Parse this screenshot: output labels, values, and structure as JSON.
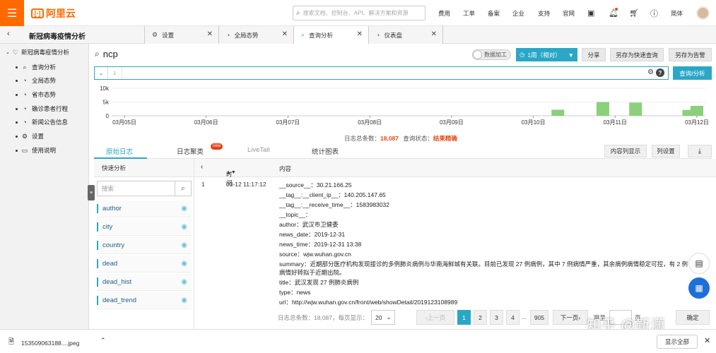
{
  "topbar": {
    "logo_text": "阿里云",
    "search_placeholder": "搜索文档、控制台、API、解决方案和资源",
    "nav": [
      "费用",
      "工单",
      "备案",
      "企业",
      "支持",
      "官网"
    ],
    "lang": "简体",
    "icons": [
      "monitor-icon",
      "bell-icon",
      "cart-icon",
      "help-icon"
    ]
  },
  "tabrow": {
    "project_title": "新冠病毒疫情分析",
    "tabs": [
      {
        "label": "设置",
        "icon": "gear-icon"
      },
      {
        "label": "全局态势",
        "icon": "dashboard-icon"
      },
      {
        "label": "查询分析",
        "icon": "search-icon"
      },
      {
        "label": "仪表盘",
        "icon": "dashboard-icon"
      }
    ],
    "active_tab": "查询分析"
  },
  "sidebar": {
    "header": "新冠病毒疫情分析",
    "items": [
      {
        "label": "查询分析",
        "icon": "search-icon"
      },
      {
        "label": "全局态势",
        "icon": "dashboard-icon"
      },
      {
        "label": "省市态势",
        "icon": "dashboard-icon"
      },
      {
        "label": "确诊患者行程",
        "icon": "dashboard-icon"
      },
      {
        "label": "新闻公告信息",
        "icon": "dashboard-icon"
      },
      {
        "label": "设置",
        "icon": "gear-icon"
      },
      {
        "label": "使用说明",
        "icon": "book-icon"
      }
    ]
  },
  "main": {
    "logstore_name": "ncp",
    "toggle_label": "数据加工",
    "time_range": "1周（相对）",
    "buttons": {
      "share": "分享",
      "save_search": "另存为快速查询",
      "save_alert": "另存为告警"
    },
    "query": {
      "line_number": "1",
      "text": "",
      "submit_label": "查询/分析"
    }
  },
  "histogram": {
    "yticks": [
      "10k",
      "5k",
      "0"
    ],
    "xticks": [
      "03月05日",
      "03月06日",
      "03月07日",
      "03月08日",
      "03月09日",
      "03月10日",
      "03月11日",
      "03月12日"
    ],
    "ymax": 10000,
    "bars": [
      {
        "position": 5.3,
        "value": 2200
      },
      {
        "position": 5.85,
        "value": 5000
      },
      {
        "position": 6.25,
        "value": 4800
      },
      {
        "position": 6.9,
        "value": 2100
      },
      {
        "position": 7.0,
        "value": 3600
      }
    ],
    "bar_color": "#8bd07b"
  },
  "stats": {
    "total_label": "日志总条数：",
    "total_value": "18,087",
    "status_label": "查询状态：",
    "status_value": "结果精确"
  },
  "subtabs": {
    "items": [
      "原始日志",
      "日志聚类",
      "LiveTail",
      "统计图表"
    ],
    "new_badge": "new",
    "content_column": "内容列显示",
    "column_settings": "列设置"
  },
  "fast_analysis": {
    "title": "快速分析",
    "search_placeholder": "搜索",
    "fields": [
      "author",
      "city",
      "country",
      "dead",
      "dead_hist",
      "dead_trend"
    ]
  },
  "log_table": {
    "col_time": "时间",
    "col_content": "内容",
    "rows": [
      {
        "index": "1",
        "time": "03-12 11:17:12",
        "lines": [
          "__source__：30.21.166.25",
          "__tag__:__client_ip__：140.205.147.65",
          "__tag__:__receive_time__：1583983032",
          "__topic__：",
          "author：武汉市卫健委",
          "news_date：2019-12-31",
          "news_time：2019-12-31 13:38",
          "source：wjw.wuhan.gov.cn",
          "summary：近期部分医疗机构发现接诊的多例肺炎病例与华南海鲜城有关联。目前已发现 27 例病例，其中 7 例病情严重，其余病例病情稳定可控，有 2 例病情好转拟于近期出院。",
          "title：武汉发现 27 例肺炎病例",
          "type：news",
          "url：http://wjw.wuhan.gov.cn/front/web/showDetail/2019123108989"
        ]
      }
    ]
  },
  "pager": {
    "summary": "日志总条数：18,087，每页显示：",
    "page_size": "20",
    "prev": "上一页",
    "pages": [
      "1",
      "2",
      "3",
      "4"
    ],
    "ellipsis": "...",
    "last": "905",
    "next": "下一页",
    "goto_label": "跳至",
    "goto_unit": "页",
    "confirm": "确定",
    "current_page": "1"
  },
  "watermark": "知乎 @靳潇",
  "download_bar": {
    "file_name": "1535090631​88....jpeg",
    "show_all": "显示全部"
  }
}
